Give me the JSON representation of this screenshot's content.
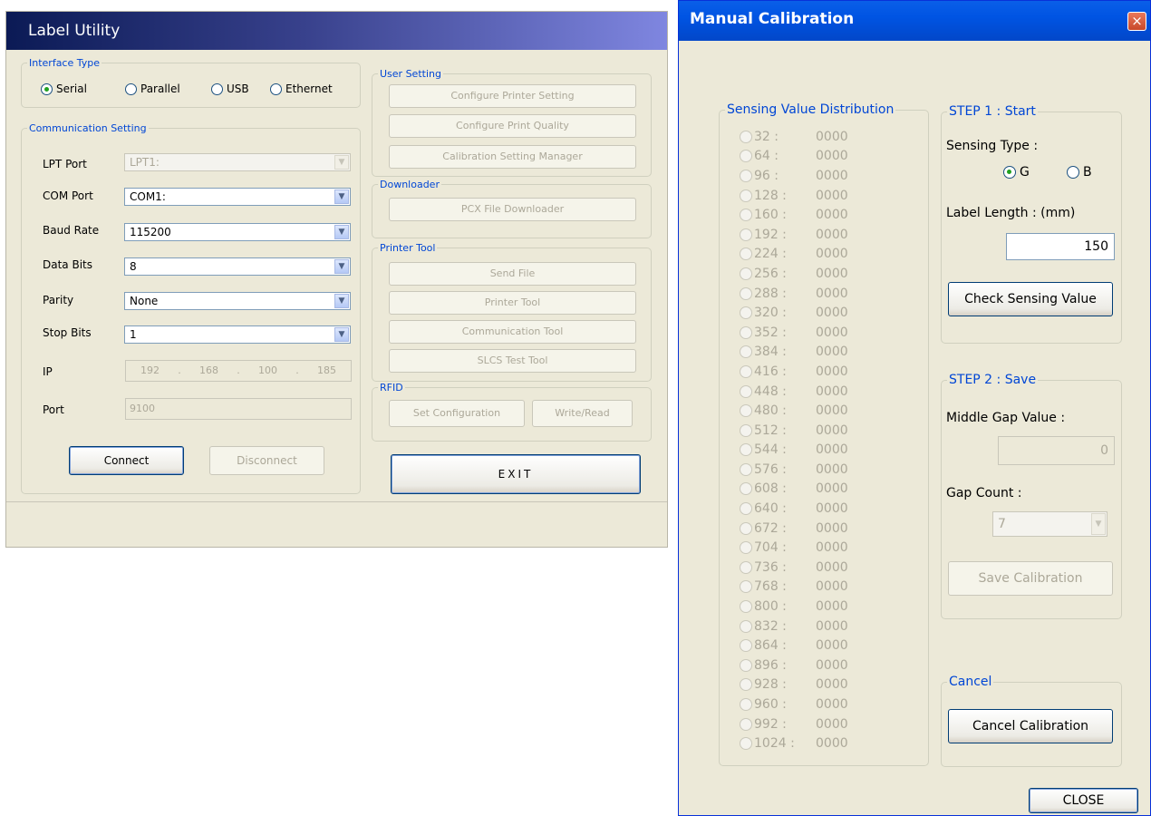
{
  "label_utility": {
    "title": "Label Utility",
    "interface_type": {
      "legend": "Interface Type",
      "options": [
        "Serial",
        "Parallel",
        "USB",
        "Ethernet"
      ],
      "selected": "Serial"
    },
    "communication": {
      "legend": "Communication Setting",
      "lpt_port_label": "LPT Port",
      "lpt_port_value": "LPT1:",
      "com_port_label": "COM Port",
      "com_port_value": "COM1:",
      "baud_rate_label": "Baud Rate",
      "baud_rate_value": "115200",
      "data_bits_label": "Data Bits",
      "data_bits_value": "8",
      "parity_label": "Parity",
      "parity_value": "None",
      "stop_bits_label": "Stop Bits",
      "stop_bits_value": "1",
      "ip_label": "IP",
      "ip_octets": [
        "192",
        "168",
        "100",
        "185"
      ],
      "ip_sep": ".",
      "port_label": "Port",
      "port_value": "9100",
      "connect": "Connect",
      "disconnect": "Disconnect"
    },
    "user_setting": {
      "legend": "User Setting",
      "configure_printer": "Configure Printer Setting",
      "configure_quality": "Configure Print Quality",
      "calibration_manager": "Calibration Setting Manager"
    },
    "downloader": {
      "legend": "Downloader",
      "pcx": "PCX File Downloader"
    },
    "printer_tool": {
      "legend": "Printer Tool",
      "send_file": "Send File",
      "printer_tool": "Printer Tool",
      "communication_tool": "Communication Tool",
      "slcs_test_tool": "SLCS Test Tool"
    },
    "rfid": {
      "legend": "RFID",
      "set_configuration": "Set Configuration",
      "write_read": "Write/Read"
    },
    "exit": "EXIT"
  },
  "manual_calibration": {
    "title": "Manual Calibration",
    "close_icon": "×",
    "distribution": {
      "legend": "Sensing Value Distribution",
      "rows": [
        {
          "n": "32 :",
          "v": "0000"
        },
        {
          "n": "64 :",
          "v": "0000"
        },
        {
          "n": "96 :",
          "v": "0000"
        },
        {
          "n": "128 :",
          "v": "0000"
        },
        {
          "n": "160 :",
          "v": "0000"
        },
        {
          "n": "192 :",
          "v": "0000"
        },
        {
          "n": "224 :",
          "v": "0000"
        },
        {
          "n": "256 :",
          "v": "0000"
        },
        {
          "n": "288 :",
          "v": "0000"
        },
        {
          "n": "320 :",
          "v": "0000"
        },
        {
          "n": "352 :",
          "v": "0000"
        },
        {
          "n": "384 :",
          "v": "0000"
        },
        {
          "n": "416 :",
          "v": "0000"
        },
        {
          "n": "448 :",
          "v": "0000"
        },
        {
          "n": "480 :",
          "v": "0000"
        },
        {
          "n": "512 :",
          "v": "0000"
        },
        {
          "n": "544 :",
          "v": "0000"
        },
        {
          "n": "576 :",
          "v": "0000"
        },
        {
          "n": "608 :",
          "v": "0000"
        },
        {
          "n": "640 :",
          "v": "0000"
        },
        {
          "n": "672 :",
          "v": "0000"
        },
        {
          "n": "704 :",
          "v": "0000"
        },
        {
          "n": "736 :",
          "v": "0000"
        },
        {
          "n": "768 :",
          "v": "0000"
        },
        {
          "n": "800 :",
          "v": "0000"
        },
        {
          "n": "832 :",
          "v": "0000"
        },
        {
          "n": "864 :",
          "v": "0000"
        },
        {
          "n": "896 :",
          "v": "0000"
        },
        {
          "n": "928 :",
          "v": "0000"
        },
        {
          "n": "960 :",
          "v": "0000"
        },
        {
          "n": "992 :",
          "v": "0000"
        },
        {
          "n": "1024 :",
          "v": "0000"
        }
      ]
    },
    "step1": {
      "legend": "STEP 1 : Start",
      "sensing_type_label": "Sensing Type :",
      "option_g": "G",
      "option_b": "B",
      "selected": "G",
      "label_length_label": "Label Length : (mm)",
      "label_length_value": "150",
      "check_button": "Check Sensing Value"
    },
    "step2": {
      "legend": "STEP 2 : Save",
      "middle_gap_label": "Middle Gap Value :",
      "middle_gap_value": "0",
      "gap_count_label": "Gap Count :",
      "gap_count_value": "7",
      "save_button": "Save Calibration"
    },
    "cancel": {
      "legend": "Cancel",
      "button": "Cancel Calibration"
    },
    "close_button": "CLOSE"
  }
}
